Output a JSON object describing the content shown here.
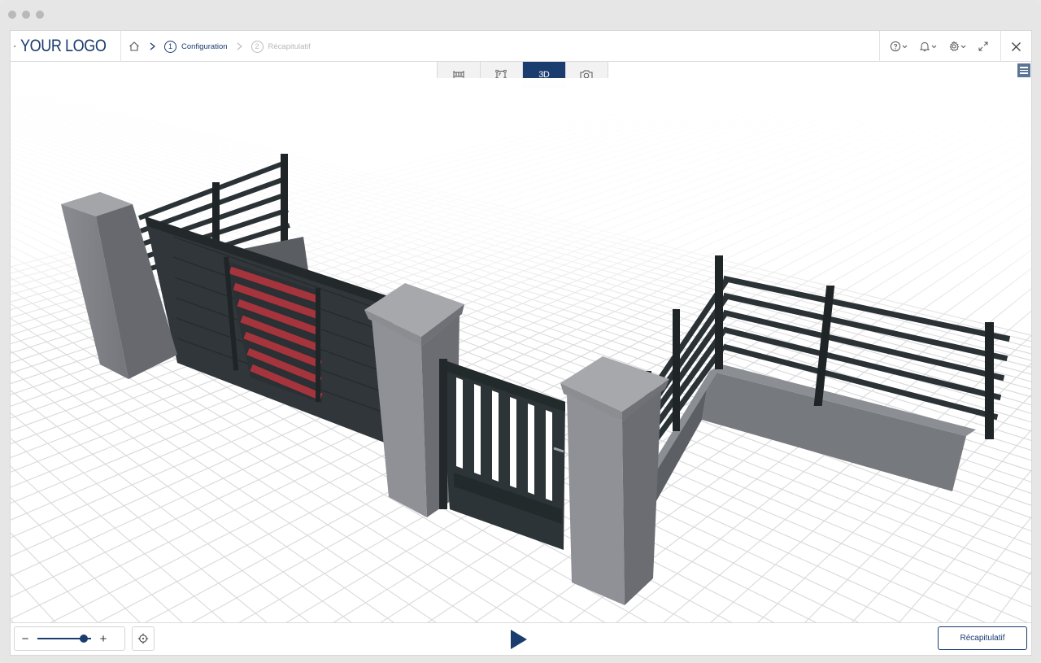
{
  "header": {
    "logo_text": "YOUR LOGO",
    "breadcrumb": [
      {
        "num": "1",
        "label": "Configuration",
        "active": true
      },
      {
        "num": "2",
        "label": "Récapitulatif",
        "active": false
      }
    ]
  },
  "toolbar": {
    "icons": [
      "help-icon",
      "bell-icon",
      "gear-icon",
      "expand-icon",
      "close-icon"
    ]
  },
  "view_switch": {
    "options": [
      "elevation-view-icon",
      "plan-view-icon",
      "3D",
      "camera-icon"
    ],
    "active": "3D",
    "label_3d": "3D"
  },
  "scene": {
    "description_colors": {
      "pillar": "#7d7f84",
      "pillar_cap": "#9c9ea3",
      "metal": "#2b3235",
      "accent_slats": "#a5343c",
      "wall": "#75787c",
      "grid_line": "#d9dadc",
      "brand": "#1b3c6e"
    }
  },
  "footer": {
    "zoom_minus": "−",
    "zoom_plus": "+",
    "zoom_level": 0.86,
    "recap_button": "Récapitulatif"
  }
}
